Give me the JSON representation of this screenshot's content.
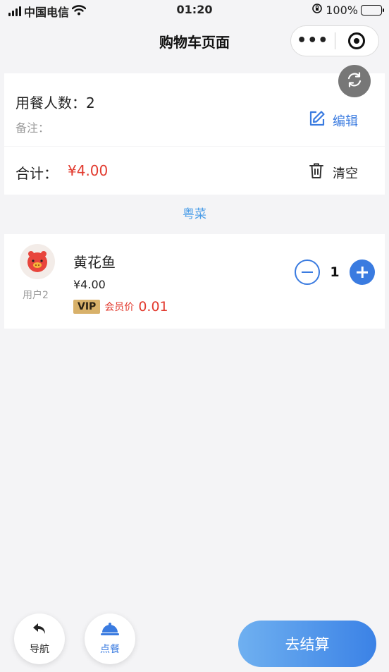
{
  "status_bar": {
    "carrier": "中国电信",
    "time": "01:20",
    "battery": "100%"
  },
  "nav": {
    "title": "购物车页面",
    "more_label": "•••"
  },
  "order_info": {
    "diners": "用餐人数：2",
    "note": "备注：",
    "edit_label": "编辑"
  },
  "summary": {
    "total_label": "合计：",
    "total_value": "¥4.00",
    "clear_label": "清空"
  },
  "category": {
    "name": "粤菜"
  },
  "cart_items": [
    {
      "user": "用户2",
      "name": "黄花鱼",
      "price": "¥4.00",
      "vip_badge": "VIP",
      "vip_label": "会员价",
      "vip_price": "0.01",
      "quantity": "1"
    }
  ],
  "bottom": {
    "nav_label": "导航",
    "order_label": "点餐",
    "checkout_label": "去结算"
  },
  "colors": {
    "accent": "#3a7be0",
    "price_red": "#e23a2e",
    "category_blue": "#4a9de8",
    "vip_gold": "#d8b16a"
  }
}
